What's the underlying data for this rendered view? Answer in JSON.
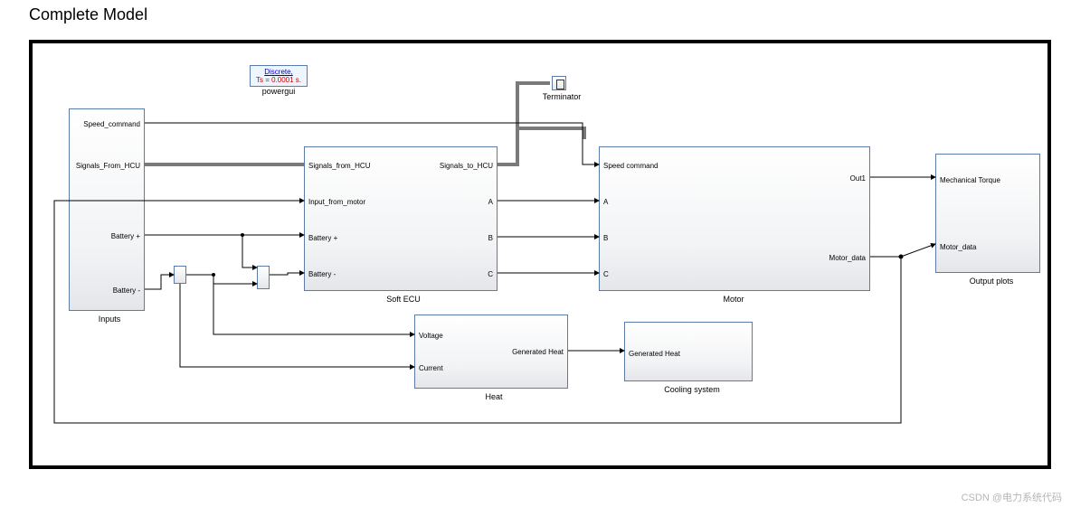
{
  "title": "Complete Model",
  "powergui": {
    "line1": "Discrete,",
    "line2": "Ts = 0.0001 s.",
    "label": "powergui"
  },
  "terminator": {
    "label": "Terminator"
  },
  "blocks": {
    "inputs": {
      "name": "Inputs",
      "ports_out": [
        "Speed_command",
        "Signals_From_HCU",
        "Battery +",
        "Battery -"
      ]
    },
    "softecu": {
      "name": "Soft ECU",
      "ports_in": [
        "Signals_from_HCU",
        "Input_from_motor",
        "Battery +",
        "Battery -"
      ],
      "ports_out": [
        "Signals_to_HCU",
        "A",
        "B",
        "C"
      ]
    },
    "motor": {
      "name": "Motor",
      "ports_in": [
        "Speed command",
        "A",
        "B",
        "C"
      ],
      "ports_out": [
        "Out1",
        "Motor_data"
      ]
    },
    "heat": {
      "name": "Heat",
      "ports_in": [
        "Voltage",
        "Current"
      ],
      "ports_out": [
        "Generated Heat"
      ]
    },
    "cooling": {
      "name": "Cooling system",
      "ports_in": [
        "Generated Heat"
      ]
    },
    "outputs": {
      "name": "Output plots",
      "ports_in": [
        "Mechanical Torque",
        "Motor_data"
      ]
    }
  },
  "watermark": "CSDN @电力系统代码"
}
